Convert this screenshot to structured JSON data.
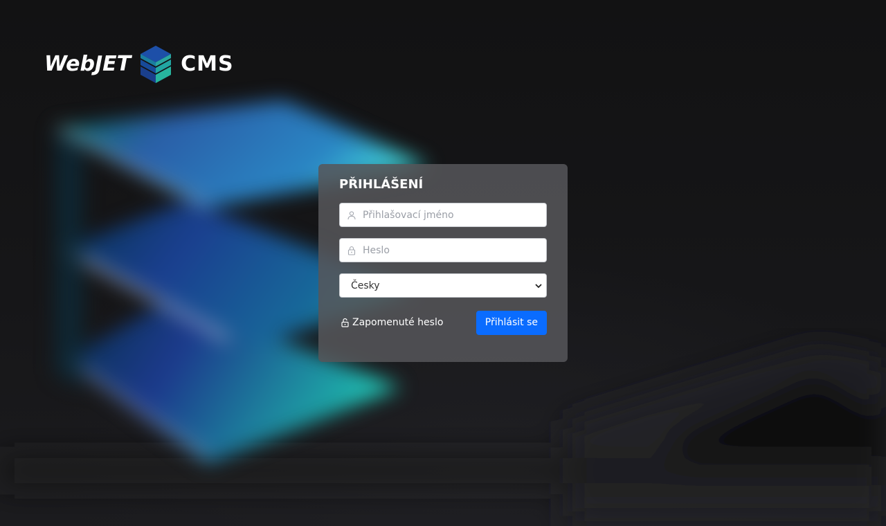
{
  "logo": {
    "left_text": "WebJET",
    "right_text": "CMS",
    "mark_icon": "webjet-cube-logo-icon"
  },
  "login": {
    "title": "PŘIHLÁŠENÍ",
    "username": {
      "value": "",
      "placeholder": "Přihlašovací jméno",
      "icon": "user-icon"
    },
    "password": {
      "value": "",
      "placeholder": "Heslo",
      "icon": "lock-icon"
    },
    "language": {
      "selected": "Česky",
      "icon": "chevron-down-icon"
    },
    "forgot_password": {
      "label": "Zapomenuté heslo",
      "icon": "lock-open-icon"
    },
    "submit_label": "Přihlásit se"
  },
  "colors": {
    "accent": "#0a6cff",
    "panel": "#56565a",
    "background": "#141416"
  }
}
